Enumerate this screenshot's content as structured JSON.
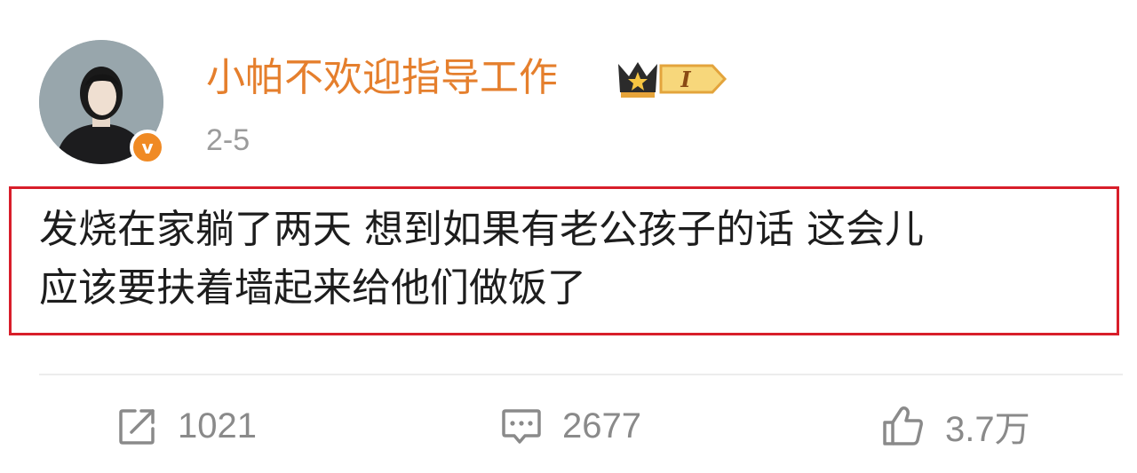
{
  "user": {
    "name": "小帕不欢迎指导工作",
    "vip_level": "I",
    "verified_mark": "v"
  },
  "post": {
    "date": "2-5",
    "text_line1": "发烧在家躺了两天 想到如果有老公孩子的话 这会儿",
    "text_line2": "应该要扶着墙起来给他们做饭了"
  },
  "actions": {
    "repost_count": "1021",
    "comment_count": "2677",
    "like_count": "3.7万"
  },
  "colors": {
    "username": "#e57f2d",
    "highlight_border": "#d81e2a",
    "verified_badge": "#f08a24",
    "action_gray": "#8a8a8a"
  },
  "icons": {
    "repost": "repost-icon",
    "comment": "comment-icon",
    "like": "thumbs-up-icon",
    "vip": "crown-icon"
  }
}
